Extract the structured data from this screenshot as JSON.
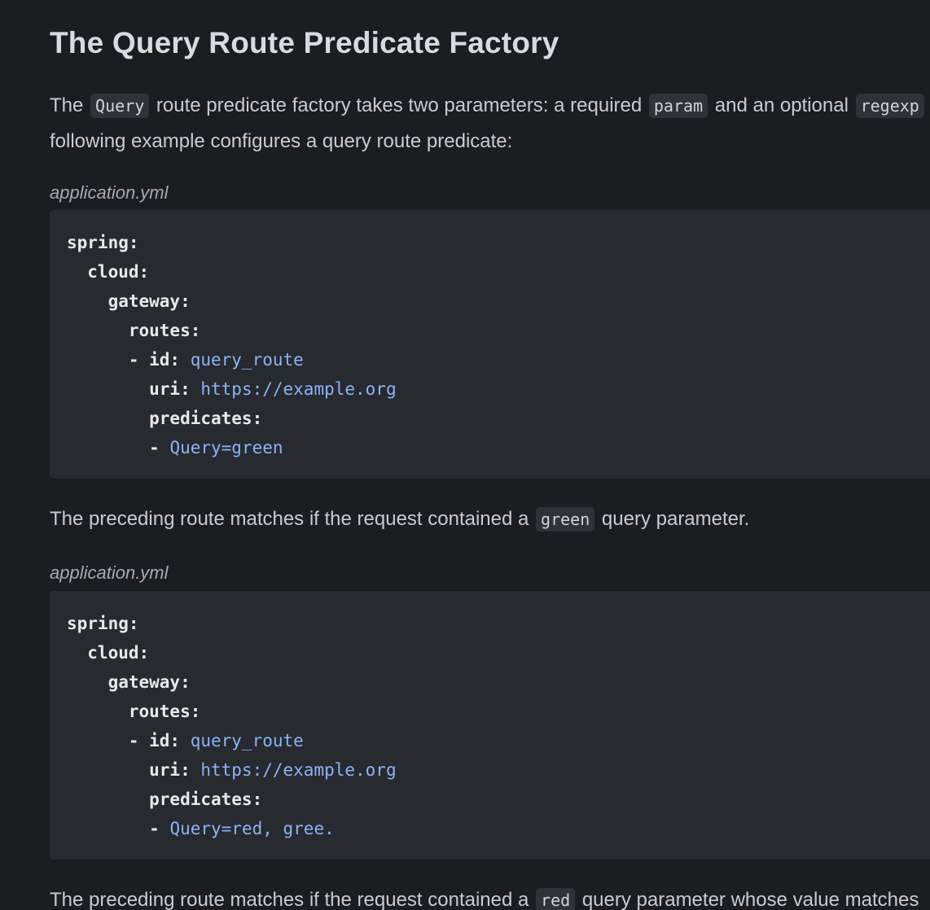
{
  "heading": "The Query Route Predicate Factory",
  "intro": {
    "t1": "The ",
    "code1": "Query",
    "t2": " route predicate factory takes two parameters: a required ",
    "code2": "param",
    "t3": " and an optional ",
    "code3": "regexp",
    "line2": "following example configures a query route predicate:"
  },
  "block1": {
    "caption": "application.yml",
    "lines": [
      {
        "indent": "",
        "key": "spring:",
        "val": ""
      },
      {
        "indent": "  ",
        "key": "cloud:",
        "val": ""
      },
      {
        "indent": "    ",
        "key": "gateway:",
        "val": ""
      },
      {
        "indent": "      ",
        "key": "routes:",
        "val": ""
      },
      {
        "indent": "      ",
        "key": "- id: ",
        "val": "query_route"
      },
      {
        "indent": "        ",
        "key": "uri: ",
        "val": "https://example.org"
      },
      {
        "indent": "        ",
        "key": "predicates:",
        "val": ""
      },
      {
        "indent": "        ",
        "key": "- ",
        "val": "Query=green"
      }
    ]
  },
  "para2": {
    "t1": "The preceding route matches if the request contained a ",
    "code": "green",
    "t2": " query parameter."
  },
  "block2": {
    "caption": "application.yml",
    "lines": [
      {
        "indent": "",
        "key": "spring:",
        "val": ""
      },
      {
        "indent": "  ",
        "key": "cloud:",
        "val": ""
      },
      {
        "indent": "    ",
        "key": "gateway:",
        "val": ""
      },
      {
        "indent": "      ",
        "key": "routes:",
        "val": ""
      },
      {
        "indent": "      ",
        "key": "- id: ",
        "val": "query_route"
      },
      {
        "indent": "        ",
        "key": "uri: ",
        "val": "https://example.org"
      },
      {
        "indent": "        ",
        "key": "predicates:",
        "val": ""
      },
      {
        "indent": "        ",
        "key": "- ",
        "val": "Query=red, gree."
      }
    ]
  },
  "para3": {
    "t1": "The preceding route matches if the request contained a ",
    "code": "red",
    "t2": " query parameter whose value matches"
  }
}
